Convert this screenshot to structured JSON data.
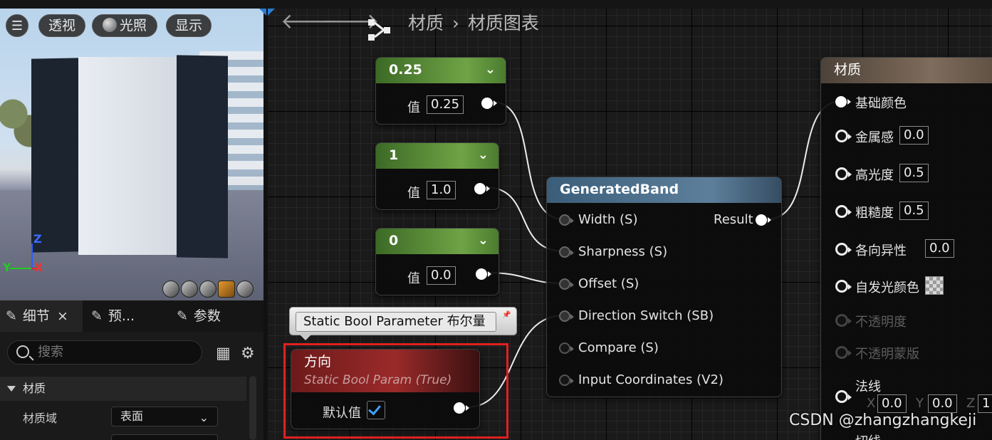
{
  "viewport": {
    "buttons": {
      "menu_icon": "hamburger-icon",
      "perspective": "透视",
      "lighting": "光照",
      "show": "显示"
    },
    "axes": {
      "z": "Z",
      "y": "Y",
      "x": "X"
    }
  },
  "details": {
    "tabs": [
      {
        "label": "细节",
        "close": "×"
      },
      {
        "label": "预..."
      },
      {
        "label": "参数"
      }
    ],
    "search_placeholder": "搜索",
    "section": "材质",
    "props": [
      {
        "label": "材质域",
        "value": "表面"
      }
    ]
  },
  "graph": {
    "breadcrumb": {
      "root": "材质",
      "sep": "›",
      "current": "材质图表"
    },
    "constants": [
      {
        "title": "0.25",
        "label": "值",
        "value": "0.25"
      },
      {
        "title": "1",
        "label": "值",
        "value": "1.0"
      },
      {
        "title": "0",
        "label": "值",
        "value": "0.0"
      }
    ],
    "generated_band": {
      "title": "GeneratedBand",
      "inputs": [
        "Width (S)",
        "Sharpness (S)",
        "Offset (S)",
        "Direction Switch (SB)",
        "Compare (S)",
        "Input Coordinates (V2)"
      ],
      "output": "Result"
    },
    "tooltip": "Static Bool Parameter 布尔量",
    "bool_param": {
      "title": "方向",
      "subtitle": "Static Bool Param (True)",
      "label": "默认值",
      "checked": true
    },
    "material": {
      "title": "材质",
      "pins": [
        {
          "label": "基础颜色"
        },
        {
          "label": "金属感",
          "value": "0.0"
        },
        {
          "label": "高光度",
          "value": "0.5"
        },
        {
          "label": "粗糙度",
          "value": "0.5"
        },
        {
          "label": "各向异性",
          "value": "0.0"
        },
        {
          "label": "自发光颜色"
        },
        {
          "label": "不透明度"
        },
        {
          "label": "不透明蒙版"
        },
        {
          "label": "法线",
          "x": "0.0",
          "y": "0.0",
          "z": "1"
        },
        {
          "label": "切线"
        }
      ],
      "vec_labels": {
        "x": "X",
        "y": "Y",
        "z": "Z"
      }
    }
  },
  "watermark": "CSDN @zhangzhangkeji",
  "colors": {
    "accent_blue": "#2b7cd3",
    "highlight_red": "#e02020",
    "constant_green": "#6fa346",
    "check_blue": "#3ea0ff"
  }
}
